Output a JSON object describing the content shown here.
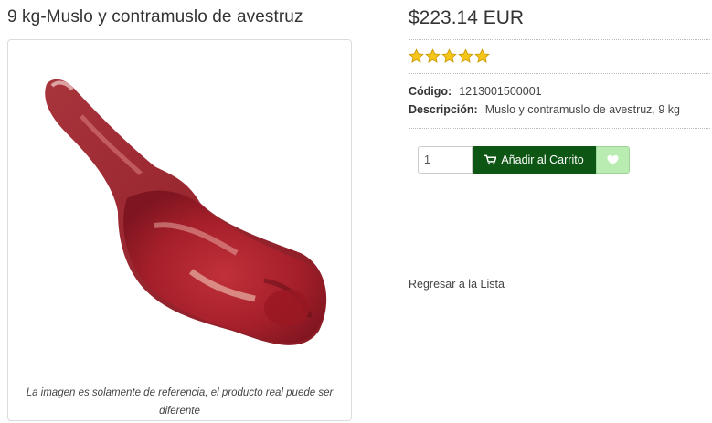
{
  "product": {
    "title": "9 kg-Muslo y contramuslo de avestruz",
    "image_caption": "La imagen es solamente de referencia, el producto real puede ser diferente",
    "price": "$223.14 EUR",
    "rating": 5,
    "rating_max": 5,
    "code_label": "Código:",
    "code_value": "1213001500001",
    "description_label": "Descripción:",
    "description_value": "Muslo y contramuslo de avestruz, 9 kg"
  },
  "cart": {
    "quantity": "1",
    "add_label": "Añadir al Carrito",
    "add_icon": "cart-icon",
    "wishlist_icon": "heart-icon"
  },
  "nav": {
    "back_label": "Regresar a la Lista"
  },
  "colors": {
    "add_button": "#0e5613",
    "wishlist_button": "#b8ecb0",
    "star": "#f5c518"
  }
}
